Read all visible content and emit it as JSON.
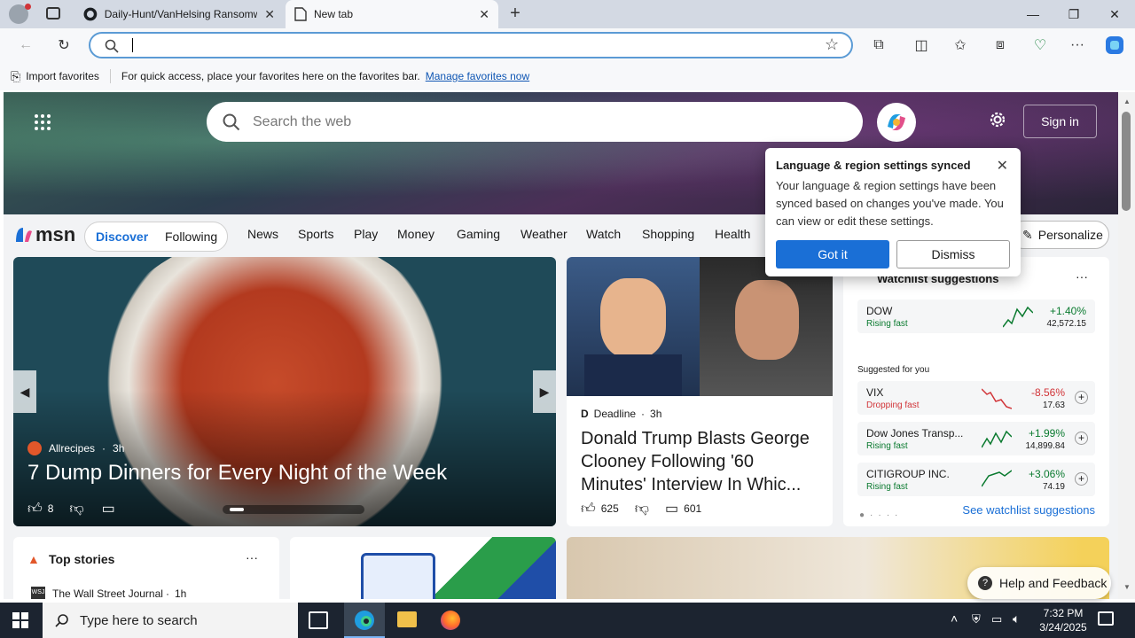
{
  "browser": {
    "tabs": [
      {
        "title": "Daily-Hunt/VanHelsing Ransomw",
        "icon": "github-icon"
      },
      {
        "title": "New tab",
        "icon": "page-icon"
      }
    ],
    "address_value": "",
    "favbar": {
      "import_label": "Import favorites",
      "message": "For quick access, place your favorites here on the favorites bar.",
      "manage_link": "Manage favorites now"
    }
  },
  "msn": {
    "search_placeholder": "Search the web",
    "sign_in": "Sign in",
    "logo_text": "msn",
    "pill_tabs": [
      "Discover",
      "Following"
    ],
    "nav": [
      "News",
      "Sports",
      "Play",
      "Money",
      "Gaming",
      "Weather",
      "Watch",
      "Shopping",
      "Health"
    ],
    "personalize": "Personalize"
  },
  "popup": {
    "title": "Language & region settings synced",
    "body": "Your language & region settings have been synced based on changes you've made. You can view or edit these settings.",
    "got_it": "Got it",
    "dismiss": "Dismiss"
  },
  "feature": {
    "source": "Allrecipes",
    "age": "3h",
    "title": "7 Dump Dinners for Every Night of the Week",
    "likes": "8"
  },
  "news": {
    "source": "Deadline",
    "age": "3h",
    "title": "Donald Trump Blasts George Clooney Following '60 Minutes' Interview In Whic...",
    "likes": "625",
    "comments": "601"
  },
  "watchlist": {
    "title": "Watchlist suggestions",
    "suggested_label": "Suggested for you",
    "see_link": "See watchlist suggestions",
    "top": {
      "name": "DOW",
      "status": "Rising fast",
      "change": "+1.40%",
      "price": "42,572.15",
      "color": "#0a7a2f"
    },
    "items": [
      {
        "name": "VIX",
        "status": "Dropping fast",
        "change": "-8.56%",
        "price": "17.63",
        "color": "#d13438"
      },
      {
        "name": "Dow Jones Transp...",
        "status": "Rising fast",
        "change": "+1.99%",
        "price": "14,899.84",
        "color": "#0a7a2f"
      },
      {
        "name": "CITIGROUP INC.",
        "status": "Rising fast",
        "change": "+3.06%",
        "price": "74.19",
        "color": "#0a7a2f"
      }
    ]
  },
  "top_stories": {
    "title": "Top stories",
    "source": "The Wall Street Journal",
    "age": "1h"
  },
  "help_feedback": "Help and Feedback",
  "taskbar": {
    "search_placeholder": "Type here to search",
    "time": "7:32 PM",
    "date": "3/24/2025"
  }
}
